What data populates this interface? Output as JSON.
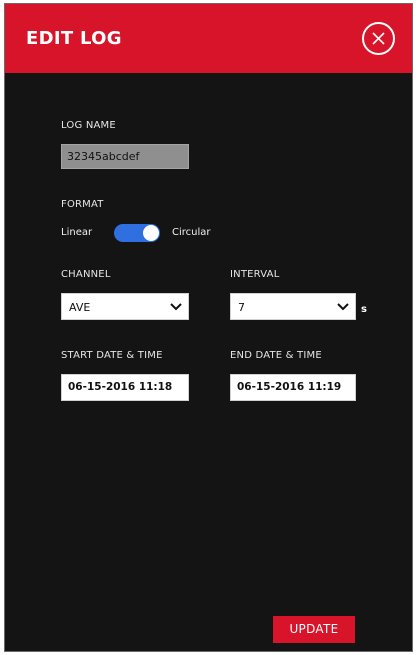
{
  "header": {
    "title": "EDIT LOG",
    "close_icon": "close-circle-icon"
  },
  "form": {
    "log_name": {
      "label": "LOG NAME",
      "value": "32345abcdef"
    },
    "format": {
      "label": "FORMAT",
      "option_left": "Linear",
      "option_right": "Circular",
      "selected": "Circular"
    },
    "channel": {
      "label": "CHANNEL",
      "value": "AVE"
    },
    "interval": {
      "label": "INTERVAL",
      "value": "7",
      "unit": "s"
    },
    "start": {
      "label": "START DATE & TIME",
      "value": "06-15-2016 11:18"
    },
    "end": {
      "label": "END DATE & TIME",
      "value": "06-15-2016 11:19"
    }
  },
  "actions": {
    "update_label": "UPDATE"
  },
  "colors": {
    "accent": "#d7142a",
    "toggle": "#2f6fe0",
    "background": "#141414"
  }
}
